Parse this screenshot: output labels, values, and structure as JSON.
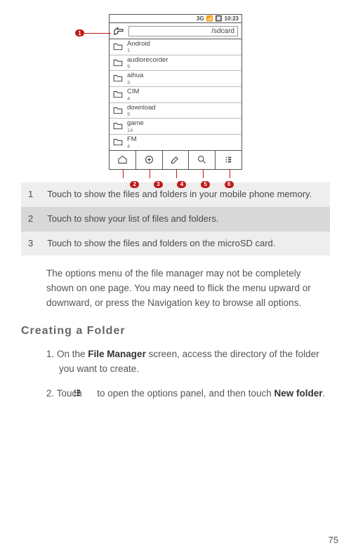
{
  "phone": {
    "status": {
      "net": "3G",
      "sig": "▮▮▯",
      "batt": "▭",
      "time": "10:23"
    },
    "path": "/sdcard",
    "files": [
      {
        "name": "Android",
        "count": "1"
      },
      {
        "name": "audiorecorder",
        "count": "9"
      },
      {
        "name": "aihua",
        "count": "3"
      },
      {
        "name": "CIM",
        "count": "4"
      },
      {
        "name": "download",
        "count": "9"
      },
      {
        "name": "game",
        "count": "14"
      },
      {
        "name": "FM",
        "count": "4"
      }
    ]
  },
  "callouts": {
    "c1": "1",
    "c2": "2",
    "c3": "3",
    "c4": "4",
    "c5": "5",
    "c6": "6"
  },
  "legend": [
    {
      "num": "1",
      "text": "Touch to show the files and folders in your mobile phone memory."
    },
    {
      "num": "2",
      "text": "Touch to show your list of files and folders."
    },
    {
      "num": "3",
      "text": "Touch to show the files and folders on the microSD card."
    }
  ],
  "paragraph": "The options menu of the file manager may not be completely shown on one page. You may need to flick the menu upward or downward, or press the Navigation key to browse all options.",
  "heading": "Creating a Folder",
  "steps": {
    "s1_pre": "1. On the ",
    "s1_b": "File Manager",
    "s1_post": " screen, access the directory of the folder you want to create.",
    "s2_pre": "2. Touch ",
    "s2_mid": " to open the options panel, and then touch ",
    "s2_b": "New folder",
    "s2_post": "."
  },
  "page": "75"
}
